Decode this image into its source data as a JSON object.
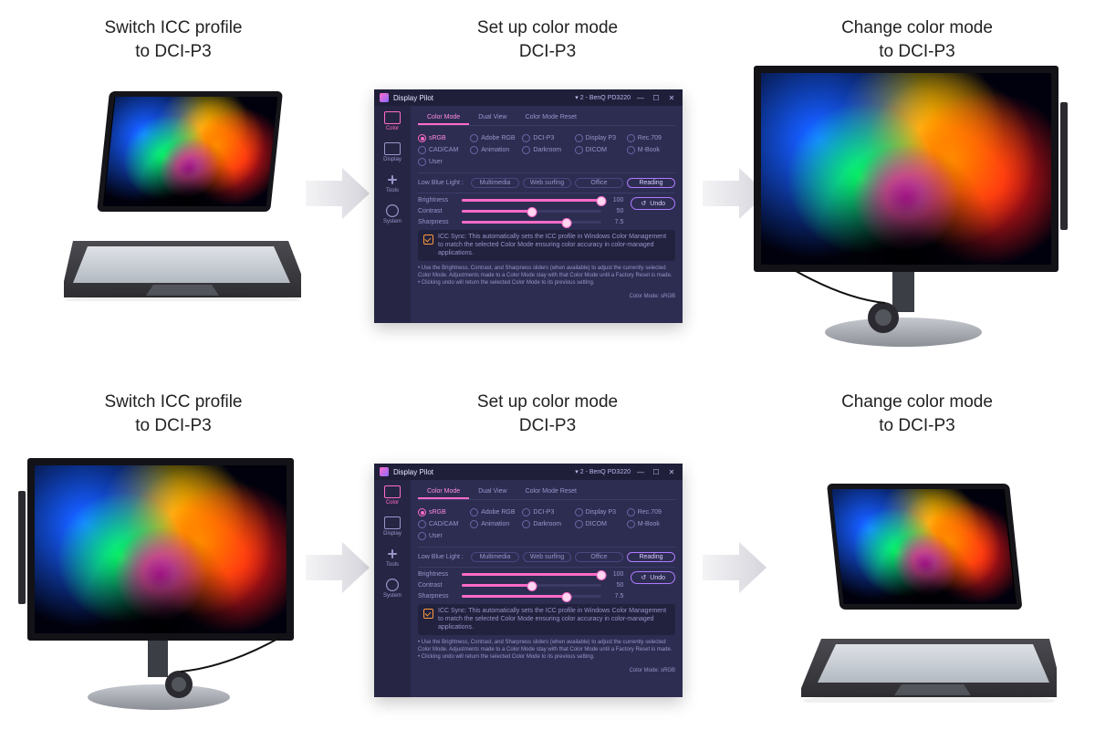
{
  "labels": {
    "left": {
      "line1": "Switch ICC profile",
      "line2": "to DCI-P3"
    },
    "mid": {
      "line1": "Set up color mode",
      "line2": "DCI-P3"
    },
    "right": {
      "line1": "Change color mode",
      "line2": "to DCI-P3"
    }
  },
  "panel": {
    "app_name": "Display Pilot",
    "monitor_dropdown": "2 - BenQ PD3220",
    "window_buttons": {
      "min": "—",
      "max": "☐",
      "close": "✕"
    },
    "sidebar": [
      {
        "icon": "color",
        "label": "Color",
        "active": true
      },
      {
        "icon": "display",
        "label": "Display",
        "active": false
      },
      {
        "icon": "tools",
        "label": "Tools",
        "active": false
      },
      {
        "icon": "system",
        "label": "System",
        "active": false
      }
    ],
    "tabs": [
      {
        "label": "Color Mode",
        "active": true
      },
      {
        "label": "Dual View",
        "active": false
      },
      {
        "label": "Color Mode Reset",
        "active": false
      }
    ],
    "color_modes": [
      {
        "label": "sRGB",
        "active": true
      },
      {
        "label": "Adobe RGB"
      },
      {
        "label": "DCI-P3"
      },
      {
        "label": "Display P3"
      },
      {
        "label": "Rec.709"
      },
      {
        "label": "CAD/CAM"
      },
      {
        "label": "Animation"
      },
      {
        "label": "Darkroom"
      },
      {
        "label": "DICOM"
      },
      {
        "label": "M-Book"
      },
      {
        "label": "User"
      }
    ],
    "lowblue": {
      "label": "Low Blue Light :",
      "options": [
        {
          "label": "Multimedia"
        },
        {
          "label": "Web surfing"
        },
        {
          "label": "Office"
        },
        {
          "label": "Reading",
          "active": true
        }
      ]
    },
    "sliders": [
      {
        "label": "Brightness",
        "value": 100,
        "max": 100
      },
      {
        "label": "Contrast",
        "value": 50,
        "max": 100
      },
      {
        "label": "Sharpness",
        "value": 7.5,
        "max": 10,
        "display": "7.5"
      }
    ],
    "undo_label": "Undo",
    "icc_text": "ICC Sync: This automatically sets the ICC profile in Windows Color Management to match the selected Color Mode ensuring color accuracy in color-managed applications.",
    "notes": [
      "• Use the Brightness, Contrast, and Sharpness sliders (when available) to adjust the currently selected Color Mode. Adjustments made to a Color Mode stay with that Color Mode until a Factory Reset is made.",
      "• Clicking undo will return the selected Color Mode to its previous setting."
    ],
    "footer_status": "Color Mode: sRGB"
  }
}
